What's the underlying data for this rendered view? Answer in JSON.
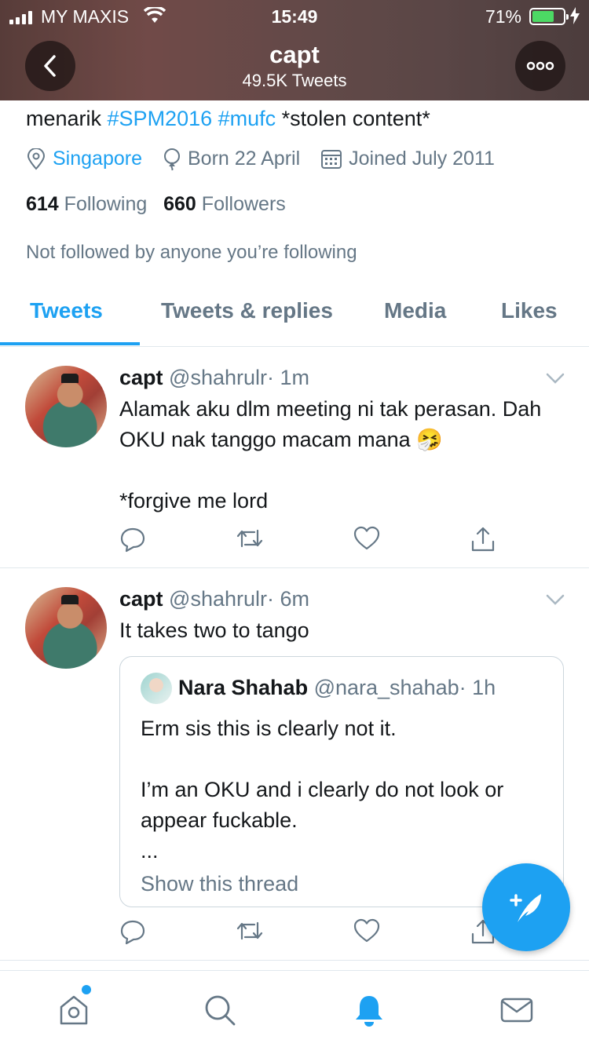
{
  "status_bar": {
    "carrier": "MY MAXIS",
    "time": "15:49",
    "battery": "71%"
  },
  "header": {
    "title": "capt",
    "subtitle": "49.5K Tweets"
  },
  "profile": {
    "bio_prefix": "menarik ",
    "bio_tag1": "#SPM2016",
    "bio_tag2": "#mufc",
    "bio_suffix": " *stolen content*",
    "location": "Singapore",
    "birthday": "Born 22 April",
    "joined": "Joined July 2011",
    "following_count": "614",
    "following_label": "Following",
    "followers_count": "660",
    "followers_label": "Followers",
    "not_followed": "Not followed by anyone you’re following"
  },
  "tabs": [
    {
      "label": "Tweets"
    },
    {
      "label": "Tweets & replies"
    },
    {
      "label": "Media"
    },
    {
      "label": "Likes"
    }
  ],
  "tweets": [
    {
      "name": "capt",
      "handle": "@shahrulr",
      "time": "· 1m",
      "body": "Alamak aku dlm meeting ni tak perasan. Dah OKU nak tanggo macam mana 🤧\n\n*forgive me lord"
    },
    {
      "name": "capt",
      "handle": "@shahrulr",
      "time": "· 6m",
      "body": "It takes two to tango",
      "quote": {
        "name": "Nara Shahab",
        "handle": "@nara_shahab",
        "time": "· 1h",
        "body": "Erm sis this is clearly not it.\n\nI’m an OKU and i clearly do not look or appear fuckable.\n...",
        "show_thread": "Show this thread"
      }
    }
  ],
  "colors": {
    "accent": "#1da1f2",
    "secondary_text": "#657786",
    "border": "#e1e8ed"
  },
  "icons": {
    "compose": "compose-tweet-icon",
    "nav": [
      "home-icon",
      "search-icon",
      "notifications-icon",
      "messages-icon"
    ]
  }
}
